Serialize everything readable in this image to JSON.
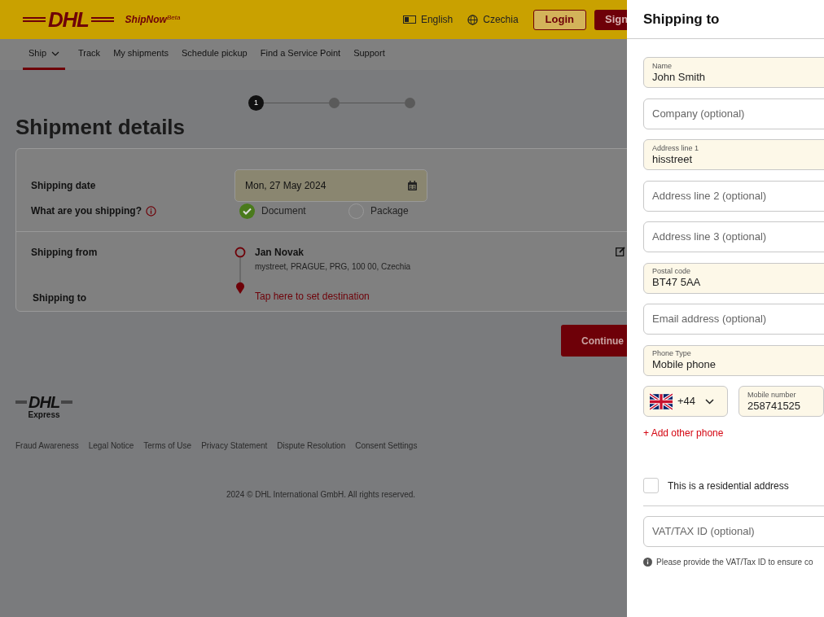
{
  "header": {
    "logo": "DHL",
    "product": "ShipNow",
    "product_badge": "Beta",
    "language": "English",
    "country": "Czechia",
    "login": "Login",
    "signup": "Sign"
  },
  "nav": {
    "items": [
      {
        "label": "Ship",
        "selected": true,
        "has_menu": true
      },
      {
        "label": "Track",
        "selected": false,
        "has_menu": false
      },
      {
        "label": "My shipments",
        "selected": false,
        "has_menu": false
      },
      {
        "label": "Schedule pickup",
        "selected": false,
        "has_menu": false
      },
      {
        "label": "Find a Service Point",
        "selected": false,
        "has_menu": false
      },
      {
        "label": "Support",
        "selected": false,
        "has_menu": false
      }
    ]
  },
  "stepper": {
    "steps": [
      {
        "label": "1",
        "selected": true
      },
      {
        "selected": false
      },
      {
        "selected": false
      }
    ]
  },
  "title": "Shipment details",
  "shipping_date": {
    "label": "Shipping date",
    "value": "Mon, 27 May 2024"
  },
  "content_type": {
    "label": "What are you shipping?",
    "options": [
      {
        "label": "Document",
        "selected": true
      },
      {
        "label": "Package",
        "selected": false
      }
    ]
  },
  "shipping_from": {
    "label": "Shipping from",
    "name": "Jan Novak",
    "address": "mystreet, PRAGUE, PRG, 100 00, Czechia"
  },
  "shipping_to": {
    "label": "Shipping to",
    "link": "Tap here to set destination"
  },
  "continue": "Continue",
  "footer": {
    "logo": "DHL",
    "logo_caption": "Express",
    "links": [
      "Fraud Awareness",
      "Legal Notice",
      "Terms of Use",
      "Privacy Statement",
      "Dispute Resolution",
      "Consent Settings"
    ],
    "copyright": "2024 © DHL International GmbH. All rights reserved."
  },
  "panel": {
    "title": "Shipping to",
    "fields": [
      {
        "label": "Name",
        "value": "John Smith"
      },
      {
        "placeholder": "Company (optional)"
      },
      {
        "label": "Address line 1",
        "value": "hisstreet"
      },
      {
        "placeholder": "Address line 2 (optional)"
      },
      {
        "placeholder": "Address line 3 (optional)"
      },
      {
        "label": "Postal code",
        "value": "BT47 5AA"
      },
      {
        "placeholder": "Email address (optional)"
      },
      {
        "label": "Phone Type",
        "value": "Mobile phone"
      }
    ],
    "phone": {
      "country_code": "+44",
      "label": "Mobile number",
      "value": "258741525"
    },
    "add_phone": "+ Add other phone",
    "residential": {
      "label": "This is a residential address",
      "checked": false
    },
    "vat": {
      "placeholder": "VAT/TAX ID (optional)"
    },
    "vat_hint": "Please provide the VAT/Tax ID to ensure co"
  }
}
